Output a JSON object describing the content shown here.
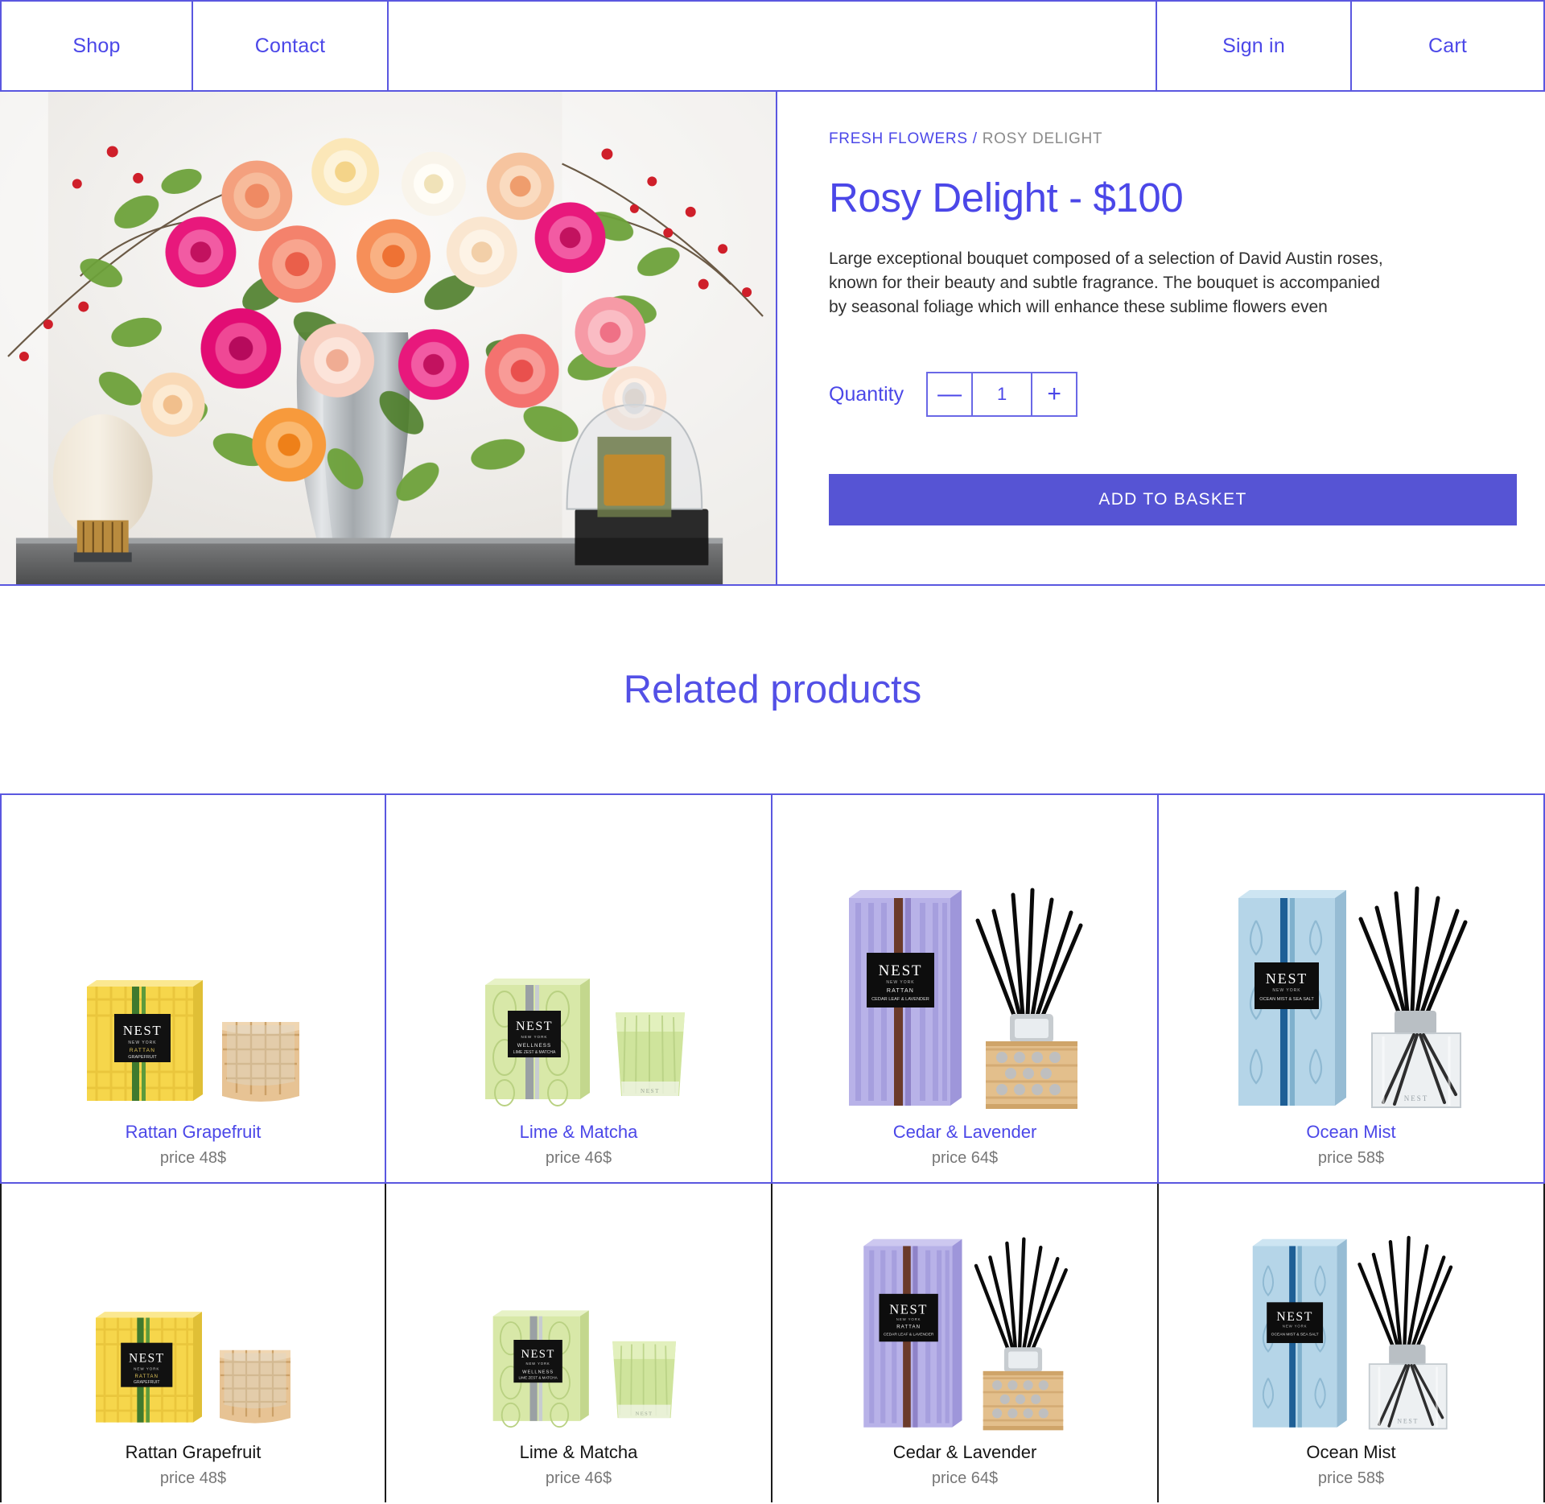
{
  "nav": {
    "items": [
      {
        "label": "Shop",
        "name": "nav-item-shop"
      },
      {
        "label": "Contact",
        "name": "nav-item-contact"
      },
      {
        "label": "Sign in",
        "name": "nav-item-signin"
      },
      {
        "label": "Cart",
        "name": "nav-item-cart"
      }
    ]
  },
  "hero": {
    "image_alt": "bouquet-of-roses-in-glass-vase",
    "breadcrumb": {
      "category": "FRESH FLOWERS",
      "separator": "/",
      "current": "ROSY DELIGHT"
    },
    "title": "Rosy Delight - $100",
    "product_name": "Rosy Delight",
    "price": "$100",
    "description": "Large exceptional bouquet composed of a selection of David Austin roses, known for their beauty and subtle fragrance. The bouquet is accompanied by seasonal foliage which will enhance these sublime flowers even",
    "quantity": {
      "label": "Quantity",
      "decrement": "—",
      "value": "1",
      "increment": "+"
    },
    "add_to_basket": "ADD TO BASKET"
  },
  "related": {
    "title": "Related products",
    "row1": [
      {
        "name": "Rattan Grapefruit",
        "price": "price 48$",
        "art": "grapefruit"
      },
      {
        "name": "Lime & Matcha",
        "price": "price 46$",
        "art": "matcha"
      },
      {
        "name": "Cedar & Lavender",
        "price": "price 64$",
        "art": "lavender"
      },
      {
        "name": "Ocean Mist",
        "price": "price 58$",
        "art": "ocean"
      }
    ],
    "row2": [
      {
        "name": "Rattan Grapefruit",
        "price": "price 48$",
        "art": "grapefruit"
      },
      {
        "name": "Lime & Matcha",
        "price": "price 46$",
        "art": "matcha"
      },
      {
        "name": "Cedar & Lavender",
        "price": "price 64$",
        "art": "lavender"
      },
      {
        "name": "Ocean Mist",
        "price": "price 58$",
        "art": "ocean"
      }
    ]
  },
  "colors": {
    "accent": "#4b47e8",
    "border": "#5a57e0",
    "button": "#5654d4",
    "muted": "#777777",
    "dark_border": "#1b1b1b"
  }
}
